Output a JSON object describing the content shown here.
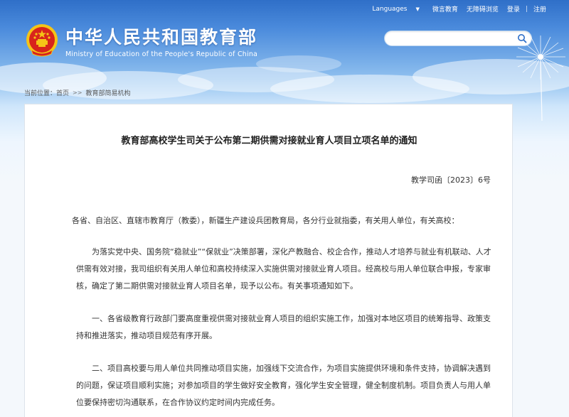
{
  "top_nav": {
    "languages": "Languages",
    "weibo": "微言教育",
    "accessibility": "无障碍浏览",
    "login": "登录",
    "register": "注册"
  },
  "header": {
    "title_cn": "中华人民共和国教育部",
    "title_en": "Ministry of Education of the People's Republic of China"
  },
  "search": {
    "value": ""
  },
  "breadcrumb": {
    "prefix": "当前位置：",
    "home": "首页",
    "section": "教育部简易机构"
  },
  "article": {
    "title": "教育部高校学生司关于公布第二期供需对接就业育人项目立项名单的通知",
    "doc_number": "教学司函〔2023〕6号",
    "greeting": "各省、自治区、直辖市教育厅（教委），新疆生产建设兵团教育局，各分行业就指委，有关用人单位，有关高校：",
    "para1": "为落实党中央、国务院“稳就业”“保就业”决策部署，深化产教融合、校企合作，推动人才培养与就业有机联动、人才供需有效对接，我司组织有关用人单位和高校持续深入实施供需对接就业育人项目。经高校与用人单位联合申报，专家审核，确定了第二期供需对接就业育人项目名单，现予以公布。有关事项通知如下。",
    "para2": "一、各省级教育行政部门要高度重视供需对接就业育人项目的组织实施工作，加强对本地区项目的统筹指导、政策支持和推进落实，推动项目规范有序开展。",
    "para3": "二、项目高校要与用人单位共同推动项目实施，加强线下交流合作，为项目实施提供环境和条件支持，协调解决遇到的问题，保证项目顺利实施；对参加项目的学生做好安全教育，强化学生安全管理，健全制度机制。项目负责人与用人单位要保持密切沟通联系，在合作协议约定时间内完成任务。"
  },
  "colors": {
    "header_blue": "#2f6fc8",
    "emblem_red": "#d8241c",
    "emblem_gold": "#f5c417"
  }
}
